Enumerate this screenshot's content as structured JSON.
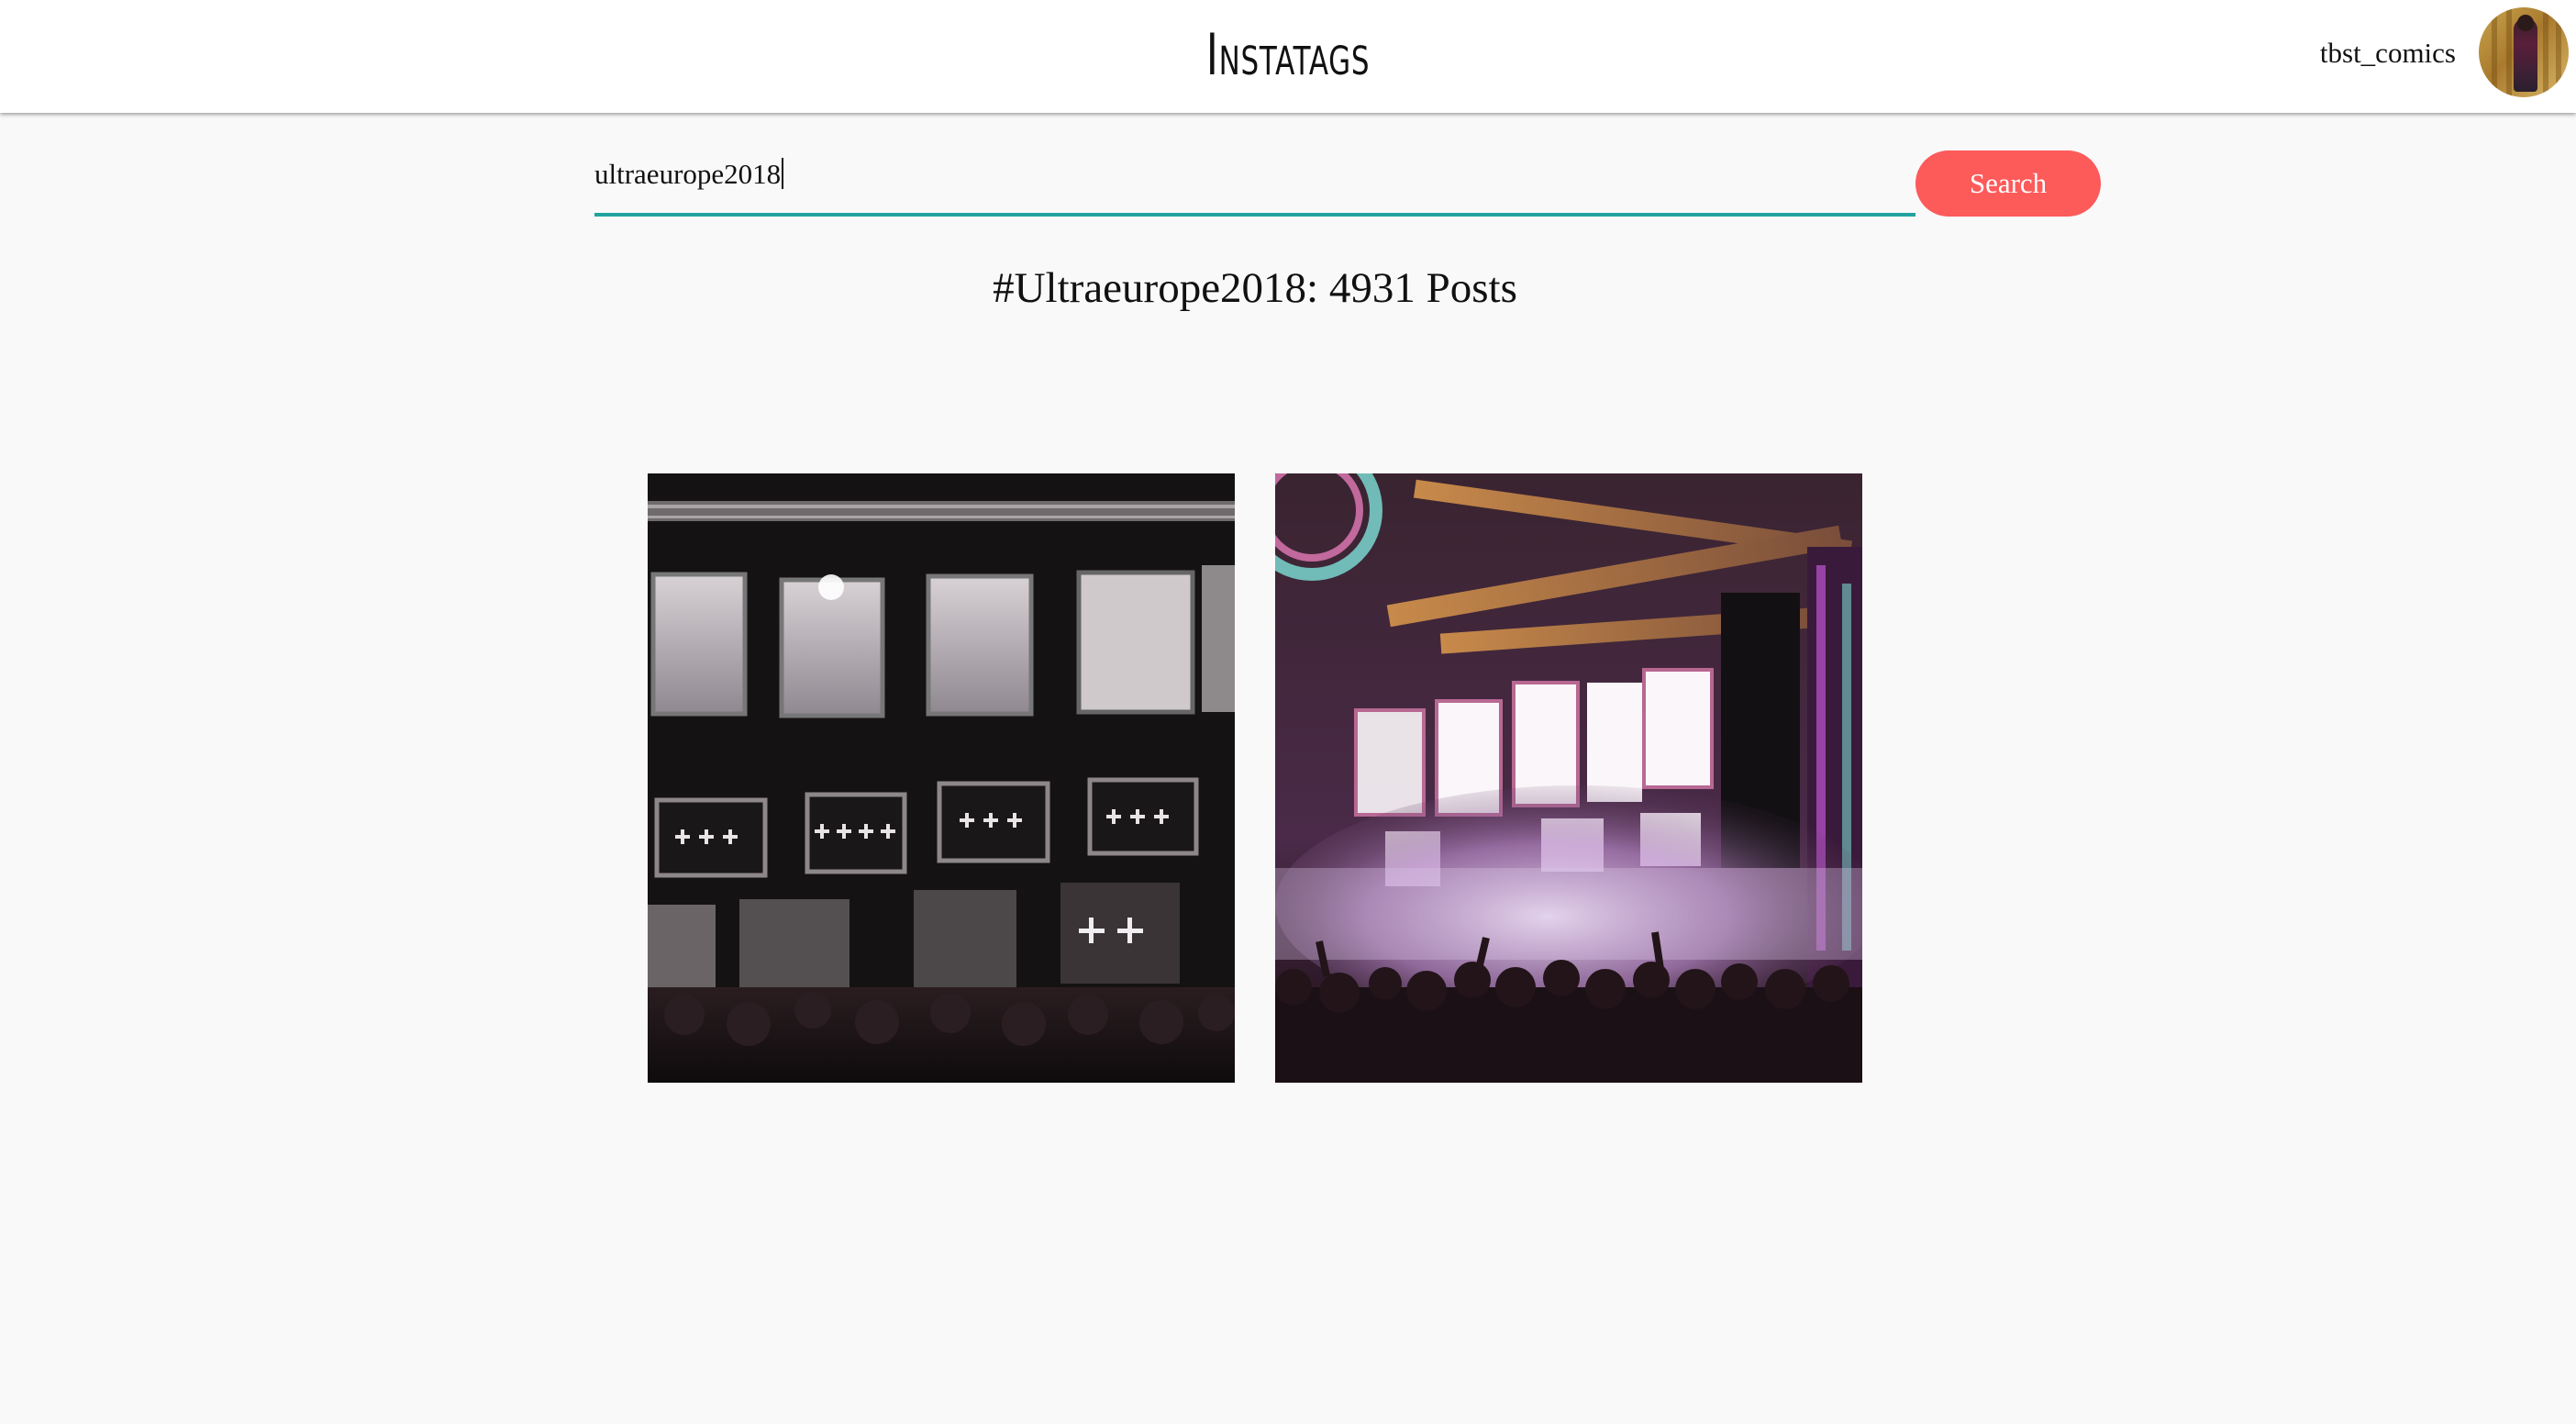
{
  "header": {
    "brand": "Instatags",
    "username": "tbst_comics"
  },
  "search": {
    "value": "ultraeurope2018",
    "button_label": "Search"
  },
  "results": {
    "heading": "#Ultraeurope2018: 4931 Posts"
  },
  "colors": {
    "accent_teal": "#22a39f",
    "button_red": "#fd5a5a"
  }
}
